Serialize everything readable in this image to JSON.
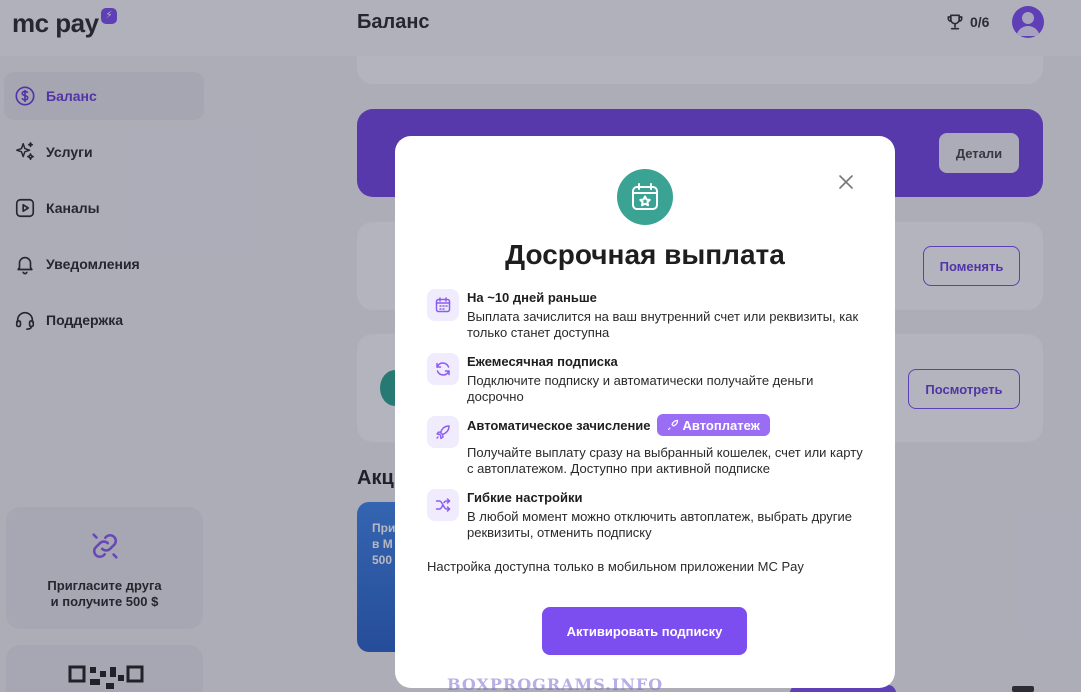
{
  "app": {
    "logo_text": "mc pay",
    "page_title": "Баланс",
    "achievements_count": "0/6"
  },
  "sidebar": {
    "items": [
      {
        "label": "Баланс",
        "icon": "dollar-circle-icon",
        "active": true
      },
      {
        "label": "Услуги",
        "icon": "sparkles-icon",
        "active": false
      },
      {
        "label": "Каналы",
        "icon": "play-square-icon",
        "active": false
      },
      {
        "label": "Уведомления",
        "icon": "bell-icon",
        "active": false
      },
      {
        "label": "Поддержка",
        "icon": "headset-icon",
        "active": false
      }
    ],
    "invite": {
      "line1": "Пригласите друга",
      "line2": "и получите 500 $"
    }
  },
  "main": {
    "details_button": "Детали",
    "change_button": "Поменять",
    "view_button": "Посмотреть",
    "section_title_partial": "Акц",
    "promo_partial": [
      "При",
      "в М",
      "500"
    ]
  },
  "modal": {
    "title": "Досрочная выплата",
    "features": [
      {
        "icon": "calendar-icon",
        "title": "На ~10 дней раньше",
        "description": "Выплата зачислится на ваш внутренний счет или реквизиты, как только станет доступна"
      },
      {
        "icon": "refresh-icon",
        "title": "Ежемесячная подписка",
        "description": "Подключите подписку и автоматически получайте деньги досрочно"
      },
      {
        "icon": "rocket-icon",
        "title": "Автоматическое зачисление",
        "badge": "Автоплатеж",
        "description": "Получайте выплату сразу на выбранный кошелек, счет или карту с автоплатежом. Доступно при активной подписке"
      },
      {
        "icon": "shuffle-icon",
        "title": "Гибкие настройки",
        "description": "В любой момент можно отключить автоплатеж, выбрать другие реквизиты, отменить подписку"
      }
    ],
    "note": "Настройка доступна только в мобильном приложении МС Pay",
    "primary_button": "Активировать подписку"
  },
  "watermark": "BOXPROGRAMS.INFO",
  "colors": {
    "accent": "#7c4ef0",
    "hero_icon_bg": "#3aa393",
    "feature_icon_bg": "#f1ecfd",
    "badge_bg": "#9a6df5"
  }
}
